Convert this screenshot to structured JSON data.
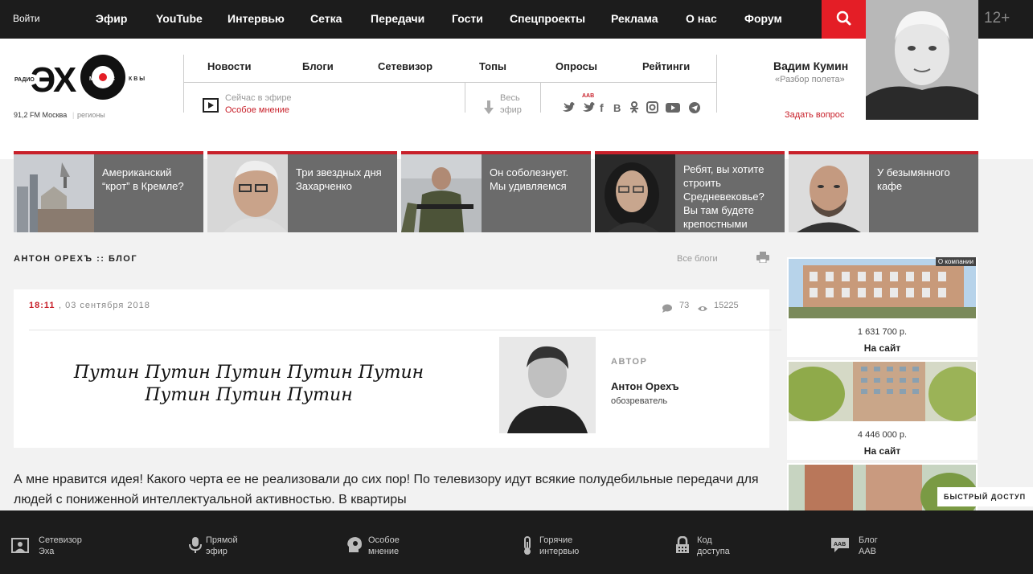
{
  "topbar": {
    "login": "Войти",
    "nav": [
      "Эфир",
      "YouTube",
      "Интервью",
      "Сетка",
      "Передачи",
      "Гости",
      "Спецпроекты",
      "Реклама",
      "О нас",
      "Форум"
    ],
    "age_rating": "12+"
  },
  "header": {
    "frequency": "91,2 FM Москва",
    "regions": "регионы",
    "subnav": [
      "Новости",
      "Блоги",
      "Сетевизор",
      "Топы",
      "Опросы",
      "Рейтинги"
    ],
    "now_on_air_label": "Сейчас в эфире",
    "now_on_air_show": "Особое мнение",
    "full_air_line1": "Весь",
    "full_air_line2": "эфир",
    "aab_label": "AAB",
    "host_name": "Вадим Кумин",
    "host_show": "«Разбор полета»",
    "ask_question": "Задать вопрос"
  },
  "teasers": [
    {
      "text": "Американский “крот” в Кремле?"
    },
    {
      "text": "Три звездных дня Захарченко"
    },
    {
      "text": "Он соболезнует. Мы удивляемся"
    },
    {
      "text": "Ребят, вы хотите строить Средневековье? Вы там будете крепостными"
    },
    {
      "text": "У безымянного кафе"
    }
  ],
  "blog": {
    "heading": "АНТОН ОРЕХЪ :: БЛОГ",
    "all_blogs": "Все блоги",
    "time": "18:11",
    "date": ", 03 сентября 2018",
    "comments": "73",
    "views": "15225",
    "title": "Путин Путин Путин Путин Путин Путин Путин Путин",
    "author_label": "АВТОР",
    "author_name": "Антон Орехъ",
    "author_role": "обозреватель",
    "body": "А мне нравится идея! Какого черта ее не реализовали до сих пор! По телевизору идут всякие полудебильные передачи для людей с пониженной интеллектуальной активностью. В квартиры"
  },
  "ads": {
    "badge": "О компании",
    "items": [
      {
        "price": "1 631 700 р.",
        "link": "На сайт"
      },
      {
        "price": "4 446 000 р.",
        "link": "На сайт"
      }
    ]
  },
  "quick_access": "БЫСТРЫЙ ДОСТУП",
  "bottombar": [
    {
      "line1": "Сетевизор",
      "line2": "Эха"
    },
    {
      "line1": "Прямой",
      "line2": "эфир"
    },
    {
      "line1": "Особое",
      "line2": "мнение"
    },
    {
      "line1": "Горячие",
      "line2": "интервью"
    },
    {
      "line1": "Код",
      "line2": "доступа"
    },
    {
      "line1": "Блог",
      "line2": "AAB"
    }
  ],
  "colors": {
    "accent": "#e41e26",
    "dark": "#1c1c1c",
    "teaser": "#6b6b6b"
  }
}
